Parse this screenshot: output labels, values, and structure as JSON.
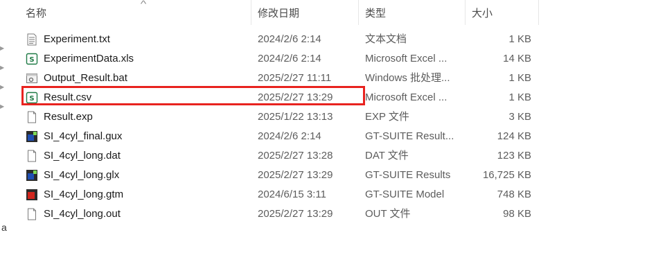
{
  "columns": {
    "name": "名称",
    "date": "修改日期",
    "type": "类型",
    "size": "大小"
  },
  "sidebar_partial_text": "a",
  "files": [
    {
      "name": "Experiment.txt",
      "date": "2024/2/6 2:14",
      "type": "文本文档",
      "size": "1 KB",
      "icon": "text-file-icon"
    },
    {
      "name": "ExperimentData.xls",
      "date": "2024/2/6 2:14",
      "type": "Microsoft Excel ...",
      "size": "14 KB",
      "icon": "spreadsheet-file-icon"
    },
    {
      "name": "Output_Result.bat",
      "date": "2025/2/27 11:11",
      "type": "Windows 批处理...",
      "size": "1 KB",
      "icon": "batch-file-icon"
    },
    {
      "name": "Result.csv",
      "date": "2025/2/27 13:29",
      "type": "Microsoft Excel ...",
      "size": "1 KB",
      "icon": "spreadsheet-file-icon",
      "highlighted": true
    },
    {
      "name": "Result.exp",
      "date": "2025/1/22 13:13",
      "type": "EXP 文件",
      "size": "3 KB",
      "icon": "blank-file-icon"
    },
    {
      "name": "SI_4cyl_final.gux",
      "date": "2024/2/6 2:14",
      "type": "GT-SUITE Result...",
      "size": "124 KB",
      "icon": "gt-suite-result-icon"
    },
    {
      "name": "SI_4cyl_long.dat",
      "date": "2025/2/27 13:28",
      "type": "DAT 文件",
      "size": "123 KB",
      "icon": "blank-file-icon"
    },
    {
      "name": "SI_4cyl_long.glx",
      "date": "2025/2/27 13:29",
      "type": "GT-SUITE Results",
      "size": "16,725 KB",
      "icon": "gt-suite-result-icon"
    },
    {
      "name": "SI_4cyl_long.gtm",
      "date": "2024/6/15 3:11",
      "type": "GT-SUITE Model",
      "size": "748 KB",
      "icon": "gt-suite-model-icon"
    },
    {
      "name": "SI_4cyl_long.out",
      "date": "2025/2/27 13:29",
      "type": "OUT 文件",
      "size": "98 KB",
      "icon": "blank-file-icon"
    }
  ],
  "colors": {
    "highlight": "#e8231f",
    "excel_green": "#1e7a45",
    "gt_blue": "#1f4fb3",
    "gt_red": "#d1261e"
  }
}
